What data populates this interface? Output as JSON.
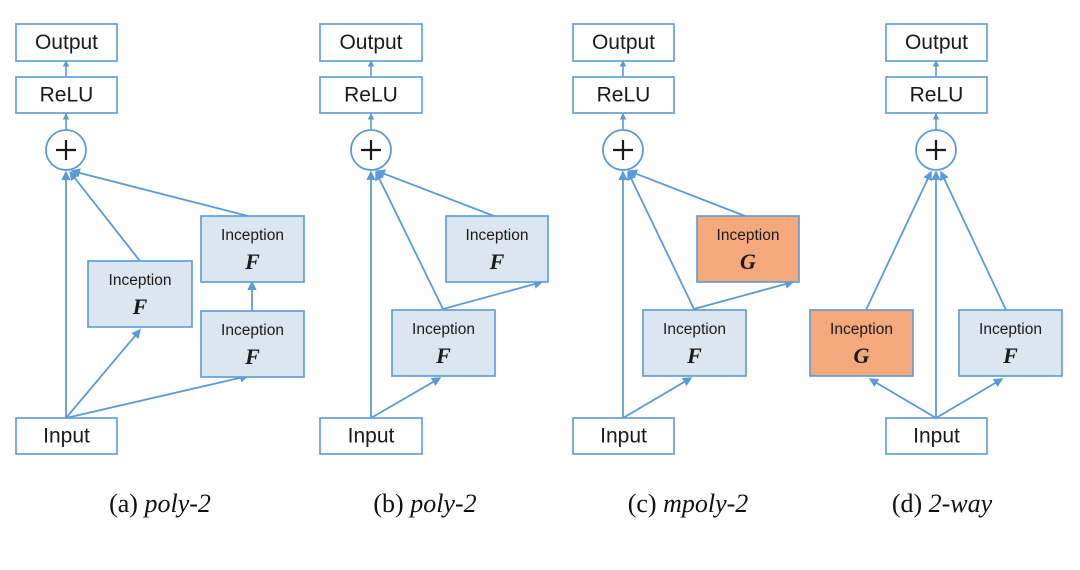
{
  "figure": {
    "background": "#ffffff",
    "colors": {
      "stroke_blue": "#5b9bd5",
      "fill_blue": "#dce6f1",
      "fill_orange": "#f4a97c",
      "fill_white": "#ffffff",
      "text": "#1a1a1a"
    },
    "common_labels": {
      "output": "Output",
      "relu": "ReLU",
      "input": "Input",
      "plus": "+",
      "inception": "Inception",
      "fn_F": "F",
      "fn_G": "G"
    }
  },
  "panels": [
    {
      "id": "a",
      "caption_tag": "(a)",
      "caption_name": "poly-2",
      "nodes": {
        "output": "Output",
        "relu": "ReLU",
        "adder": "+",
        "input": "Input",
        "block_mid": {
          "title": "Inception",
          "fn": "F",
          "fill": "#dce6f1"
        },
        "block_right_top": {
          "title": "Inception",
          "fn": "F",
          "fill": "#dce6f1"
        },
        "block_right_bottom": {
          "title": "Inception",
          "fn": "F",
          "fill": "#dce6f1"
        }
      }
    },
    {
      "id": "b",
      "caption_tag": "(b)",
      "caption_name": "poly-2",
      "nodes": {
        "output": "Output",
        "relu": "ReLU",
        "adder": "+",
        "input": "Input",
        "block_top": {
          "title": "Inception",
          "fn": "F",
          "fill": "#dce6f1"
        },
        "block_bottom": {
          "title": "Inception",
          "fn": "F",
          "fill": "#dce6f1"
        }
      }
    },
    {
      "id": "c",
      "caption_tag": "(c)",
      "caption_name": "mpoly-2",
      "nodes": {
        "output": "Output",
        "relu": "ReLU",
        "adder": "+",
        "input": "Input",
        "block_top": {
          "title": "Inception",
          "fn": "G",
          "fill": "#f4a97c"
        },
        "block_bottom": {
          "title": "Inception",
          "fn": "F",
          "fill": "#dce6f1"
        }
      }
    },
    {
      "id": "d",
      "caption_tag": "(d)",
      "caption_name": "2-way",
      "nodes": {
        "output": "Output",
        "relu": "ReLU",
        "adder": "+",
        "input": "Input",
        "block_left": {
          "title": "Inception",
          "fn": "G",
          "fill": "#f4a97c"
        },
        "block_right": {
          "title": "Inception",
          "fn": "F",
          "fill": "#dce6f1"
        }
      }
    }
  ]
}
